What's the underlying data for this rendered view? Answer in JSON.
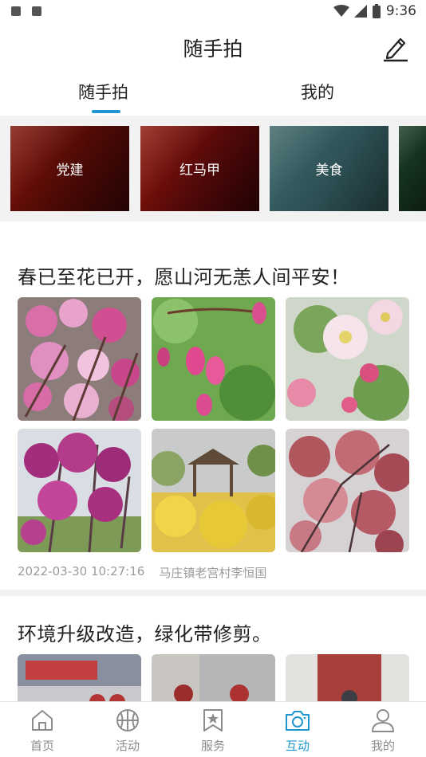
{
  "status_bar": {
    "time": "9:36",
    "battery": "8"
  },
  "header": {
    "title": "随手拍",
    "edit_icon": "pencil-icon"
  },
  "tabs": [
    {
      "label": "随手拍",
      "active": true
    },
    {
      "label": "我的",
      "active": false
    }
  ],
  "categories": [
    {
      "label": "党建"
    },
    {
      "label": "红马甲"
    },
    {
      "label": "美食"
    }
  ],
  "posts": [
    {
      "title": "春已至花已开，愿山河无恙人间平安！",
      "timestamp": "2022-03-30 10:27:16",
      "author": "马庄镇老宫村李恒国"
    },
    {
      "title": "环境升级改造，绿化带修剪。"
    }
  ],
  "bottom_nav": [
    {
      "label": "首页",
      "icon": "home-icon"
    },
    {
      "label": "活动",
      "icon": "basketball-icon"
    },
    {
      "label": "服务",
      "icon": "bookmark-star-icon"
    },
    {
      "label": "互动",
      "icon": "camera-icon",
      "active": true
    },
    {
      "label": "我的",
      "icon": "user-icon"
    }
  ],
  "colors": {
    "accent": "#1f95cf",
    "meta_text": "#9b9b9b"
  }
}
